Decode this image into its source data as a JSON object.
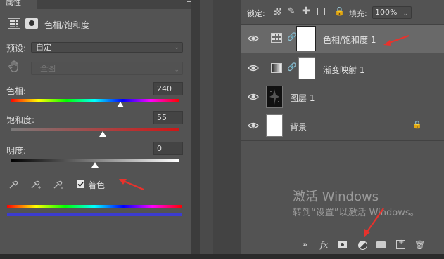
{
  "properties": {
    "tab_label": "属性",
    "title": "色相/饱和度",
    "preset_label": "预设:",
    "preset_value": "自定",
    "channel_value": "全图",
    "hue_label": "色相:",
    "hue_value": "240",
    "hue_fraction": 0.667,
    "saturation_label": "饱和度:",
    "saturation_value": "55",
    "saturation_fraction": 0.55,
    "lightness_label": "明度:",
    "lightness_value": "0",
    "lightness_fraction": 0.5,
    "colorize_label": "着色",
    "colorize_checked": true
  },
  "layers": {
    "lock_label": "锁定:",
    "fill_label": "填充:",
    "fill_value": "100%",
    "items": [
      {
        "name": "色相/饱和度 1",
        "icon": "hue-saturation-adjustment-icon"
      },
      {
        "name": "渐变映射 1",
        "icon": "gradient-map-adjustment-icon"
      },
      {
        "name": "图层 1",
        "icon": "image-thumbnail"
      },
      {
        "name": "背景",
        "icon": "white-thumbnail",
        "locked": true
      }
    ]
  },
  "watermark": {
    "line1": "激活 Windows",
    "line2": "转到“设置”以激活 Windows。"
  },
  "colors": {
    "panel_bg": "#535353",
    "selected_row": "#696969",
    "annotation_arrow": "#e8322c",
    "colorize_bar": "#3c3ccf"
  }
}
